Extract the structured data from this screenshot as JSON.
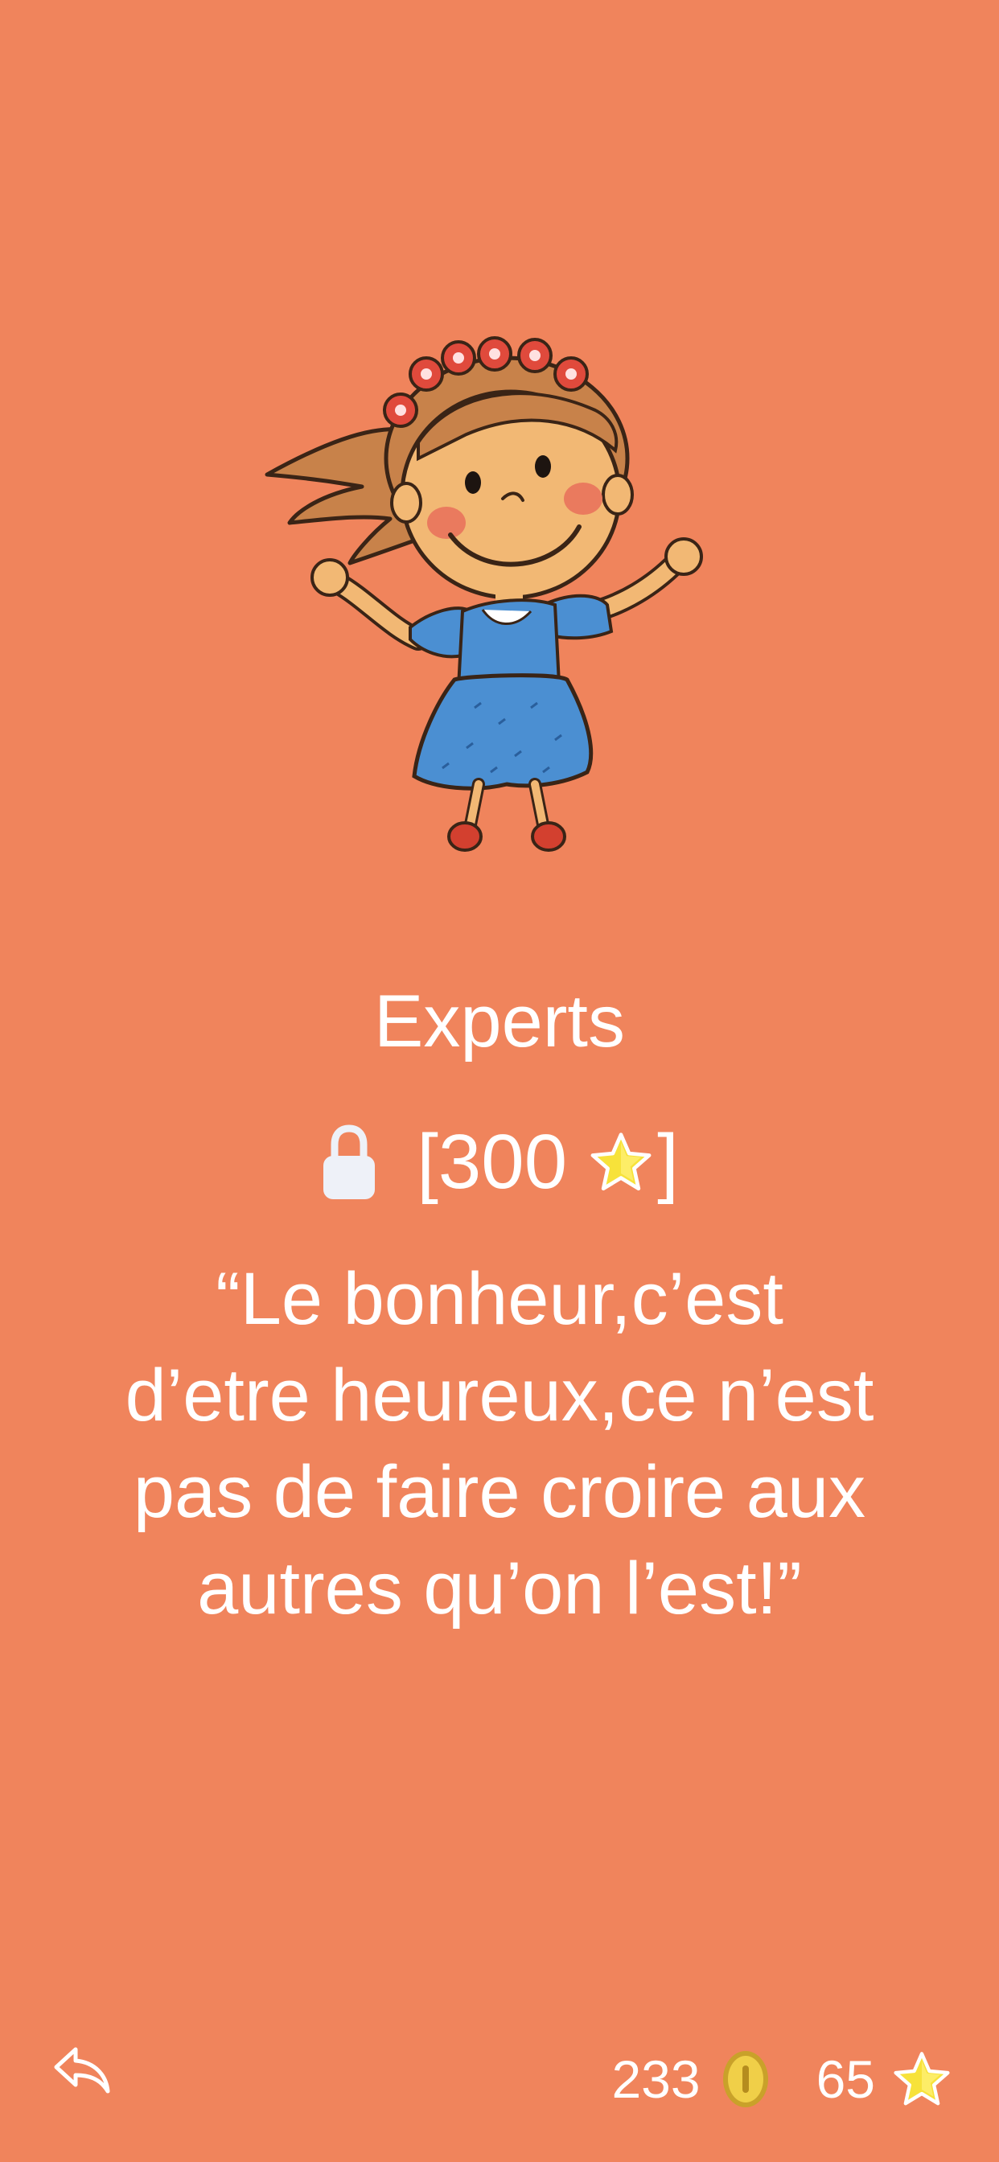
{
  "level": {
    "title": "Experts",
    "cost_open": "[300",
    "cost_close": "]",
    "lock_icon": "lock-icon",
    "star_icon": "star-icon"
  },
  "quote": {
    "text": "“Le bonheur,c’est d’etre heureux,ce n’est pas de faire croire aux autres qu’on l’est!”"
  },
  "footer": {
    "back_icon": "reply-arrow-icon",
    "coins": "233",
    "coin_icon": "coin-icon",
    "stars": "65",
    "star_icon": "star-icon"
  },
  "colors": {
    "background": "#F0845C",
    "text": "#FFFFFF",
    "lock": "#EEF1F8",
    "star": "#F7E23A",
    "coin": "#E8C33A"
  }
}
